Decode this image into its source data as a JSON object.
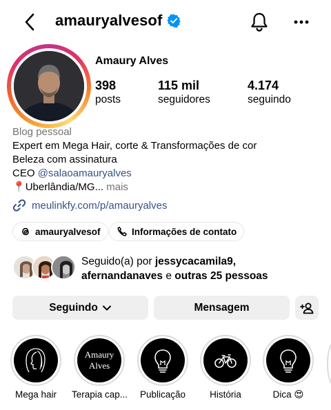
{
  "header": {
    "username": "amauryalvesof",
    "icons": {
      "back": "back-arrow-icon",
      "verified": "verified-badge-icon",
      "notifications": "bell-icon",
      "more": "more-options-icon"
    }
  },
  "profile": {
    "full_name": "Amaury Alves",
    "stats": [
      {
        "value": "398",
        "label": "posts"
      },
      {
        "value": "115 mil",
        "label": "seguidores"
      },
      {
        "value": "4.174",
        "label": "seguindo"
      }
    ]
  },
  "bio": {
    "category": "Blog pessoal",
    "line1": "Expert em Mega Hair, corte  & Transformações de cor",
    "line2": "Beleza com assinatura",
    "ceo_prefix": "CEO ",
    "ceo_handle": "@salaoamauryalves",
    "location_pin": "📍",
    "location": "Uberlândia/MG...",
    "more": " mais",
    "url": "meulinkfy.com/p/amauryalves"
  },
  "chips": {
    "threads": "amauryalvesof",
    "contact": "Informações de contato"
  },
  "followed_by": {
    "prefix": "Seguido(a) por ",
    "user1": "jessycacamila9",
    "sep": ",",
    "user2": "afernandanaves",
    "and": " e ",
    "others": "outras 25 pessoas"
  },
  "actions": {
    "following": "Seguindo",
    "message": "Mensagem"
  },
  "highlights": [
    {
      "label": "Mega hair"
    },
    {
      "label": "Terapia cap...",
      "cover_text_1": "Amaury",
      "cover_text_2": "Alves"
    },
    {
      "label": "Publicação"
    },
    {
      "label": "História"
    },
    {
      "label": "Dica 😍"
    }
  ],
  "colors": {
    "link": "#385185",
    "secondary_text": "#737373",
    "button_bg": "#efefef",
    "verified": "#0095f6"
  }
}
